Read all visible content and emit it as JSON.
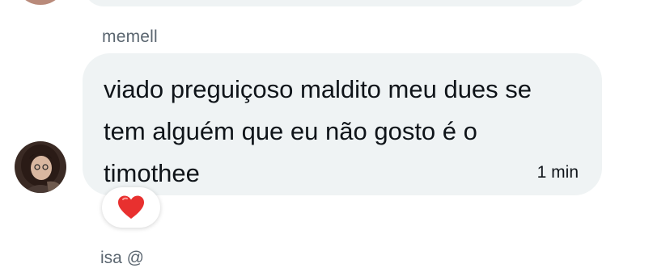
{
  "message": {
    "sender": "memell",
    "text": "viado preguiçoso maldito meu dues se\ntem alguém que eu não gosto é o\ntimothee",
    "timestamp": "1 min",
    "reaction": "heart"
  },
  "next_message": {
    "sender": "isa @"
  },
  "colors": {
    "bubble": "#eff3f4",
    "text": "#0f1419",
    "muted": "#5b6670",
    "heart": "#e8302f"
  }
}
